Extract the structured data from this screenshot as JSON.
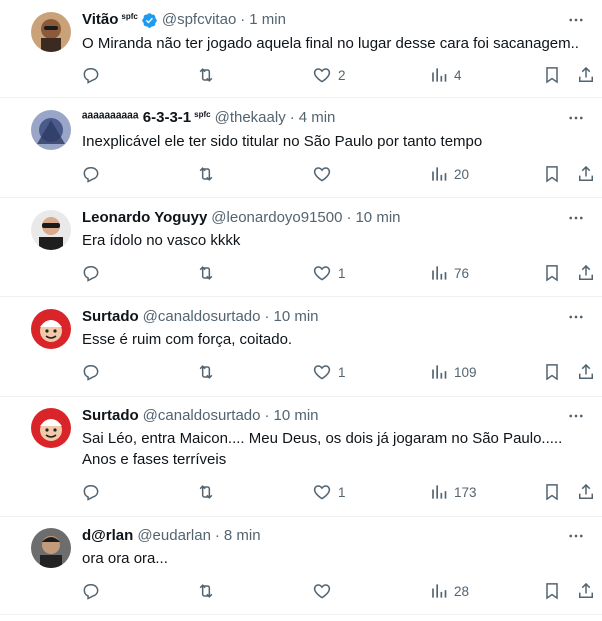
{
  "tweets": [
    {
      "name": "Vitão",
      "name_suffix": "spfc",
      "verified": true,
      "handle": "@spfcvitao",
      "time": "1 min",
      "text": "O Miranda não ter jogado aquela final no lugar desse cara foi sacanagem..",
      "likes": "2",
      "views": "4",
      "avatar_color": "#6b4a32"
    },
    {
      "name": "ᵃᵃᵃᵃᵃᵃᵃᵃᵃᵃ 6-3-3-1",
      "name_suffix": "spfc",
      "verified": false,
      "handle": "@thekaaly",
      "time": "4 min",
      "text": "Inexplicável ele ter sido titular no São Paulo por tanto tempo",
      "likes": "",
      "views": "20",
      "avatar_color": "#5a6a9a"
    },
    {
      "name": "Leonardo Yoguyy",
      "name_suffix": "",
      "verified": false,
      "handle": "@leonardoyo91500",
      "time": "10 min",
      "text": "Era ídolo no vasco kkkk",
      "likes": "1",
      "views": "76",
      "avatar_color": "#2b2b2b"
    },
    {
      "name": "Surtado",
      "name_suffix": "",
      "verified": false,
      "handle": "@canaldosurtado",
      "time": "10 min",
      "text": "Esse é ruim com força, coitado.",
      "likes": "1",
      "views": "109",
      "avatar_color": "#d9252a"
    },
    {
      "name": "Surtado",
      "name_suffix": "",
      "verified": false,
      "handle": "@canaldosurtado",
      "time": "10 min",
      "text": "Sai Léo, entra Maicon.... Meu Deus, os dois já jogaram no São Paulo.....\nAnos e fases terríveis",
      "likes": "1",
      "views": "173",
      "avatar_color": "#d9252a"
    },
    {
      "name": "d@rlan",
      "name_suffix": "",
      "verified": false,
      "handle": "@eudarlan",
      "time": "8 min",
      "text": "ora ora ora...",
      "likes": "",
      "views": "28",
      "avatar_color": "#2f2f2f"
    }
  ],
  "separator": "·",
  "more_glyph": "···",
  "colors": {
    "text": "#0f1419",
    "secondary": "#536471",
    "verified": "#1d9bf0",
    "border": "#eff3f4"
  }
}
